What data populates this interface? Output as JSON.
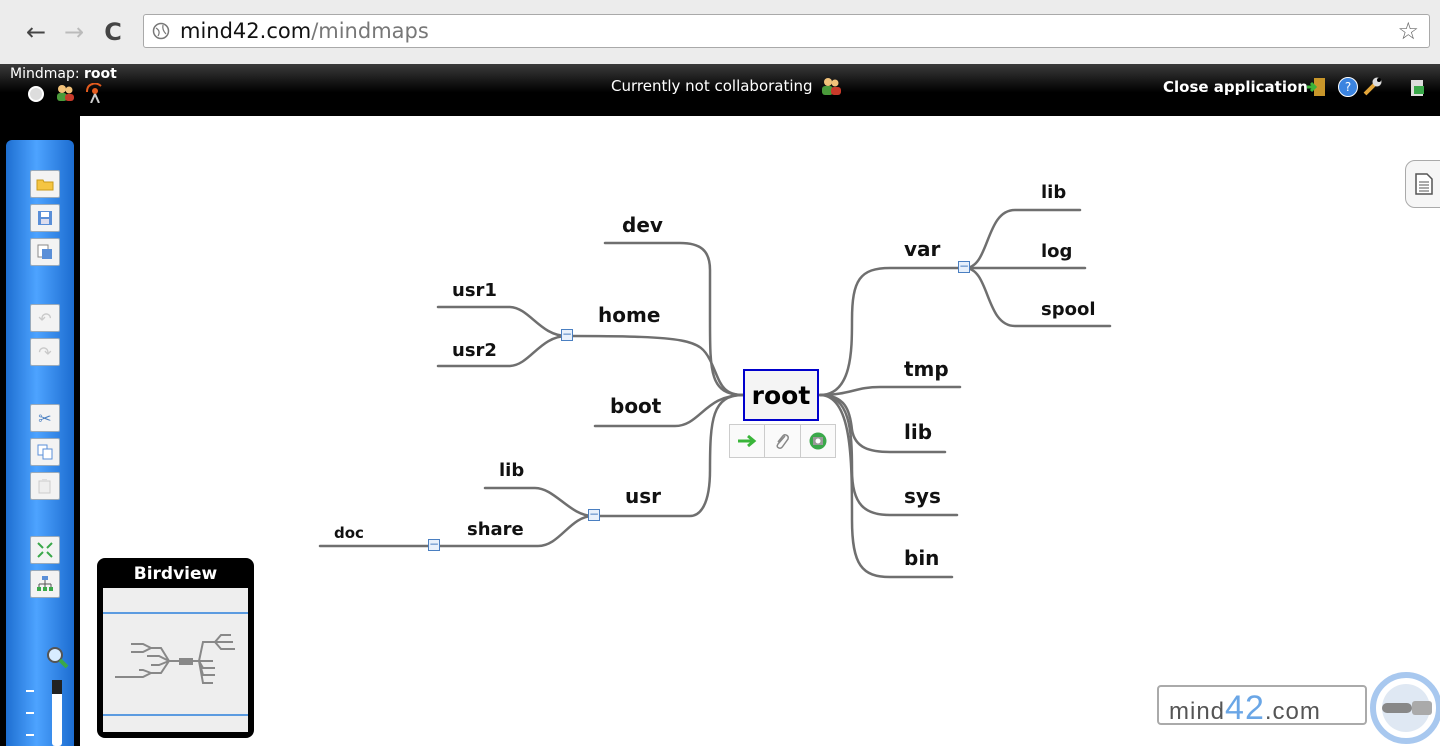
{
  "browser": {
    "url_domain": "mind42.com",
    "url_path": "/mindmaps"
  },
  "header": {
    "mindmap_prefix": "Mindmap:",
    "mindmap_name": "root",
    "collab_status": "Currently not collaborating",
    "close_label": "Close application"
  },
  "mindmap": {
    "root": "root",
    "nodes": {
      "dev": "dev",
      "home": "home",
      "usr1": "usr1",
      "usr2": "usr2",
      "boot": "boot",
      "usr": "usr",
      "lib_usr": "lib",
      "share": "share",
      "doc": "doc",
      "var": "var",
      "lib_var": "lib",
      "log": "log",
      "spool": "spool",
      "tmp": "tmp",
      "lib": "lib",
      "sys": "sys",
      "bin": "bin"
    }
  },
  "birdview": {
    "title": "Birdview"
  },
  "logo": {
    "prefix": "mind",
    "number": "42",
    "suffix": ".com"
  },
  "icons": {
    "back": "back-arrow-icon",
    "forward": "forward-arrow-icon",
    "reload": "reload-icon",
    "star": "star-icon"
  }
}
